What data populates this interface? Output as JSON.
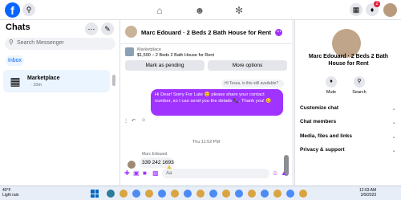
{
  "topbar": {
    "logo": "f",
    "search_icon": "search-icon",
    "notification_count": "2"
  },
  "sidebar": {
    "title": "Chats",
    "search_placeholder": "Search Messenger",
    "filter_label": "Inbox",
    "conversation": {
      "name": "Marketplace",
      "time": "· 10m"
    }
  },
  "chat": {
    "title": "Marc Edouard · 2 Beds 2 Bath House for Rent",
    "marketplace_label": "Marketplace",
    "listing": "$1,500 – 2 Beds 2 Bath House for Rent",
    "mark_pending_label": "Mark as pending",
    "more_options_label": "More options",
    "quoted_reply": "Hi Tessa, is this still available?",
    "outgoing_message": "Hi Dear! Sorry For Late 😊 please share your contact number, so I can send you the details 📞. Thank you! 😊",
    "timestamp": "Thu 11:52 PM",
    "sender_name": "Marc Edouard",
    "incoming_message": "339 242 1693",
    "reaction": "👍",
    "composer_placeholder": "Aa"
  },
  "details": {
    "title": "Marc Edouard · 2 Beds 2 Bath House for Rent",
    "mute_label": "Mute",
    "search_label": "Search",
    "items": [
      "Customize chat",
      "Chat members",
      "Media, files and links",
      "Privacy & support"
    ]
  },
  "taskbar": {
    "weather_temp": "40°F",
    "weather_desc": "Light rain",
    "time": "12:03 AM",
    "date": "3/9/2023"
  },
  "colors": {
    "brand": "#0866ff",
    "accent": "#a033ff",
    "surface": "#ffffff",
    "background": "#f0f2f5"
  }
}
